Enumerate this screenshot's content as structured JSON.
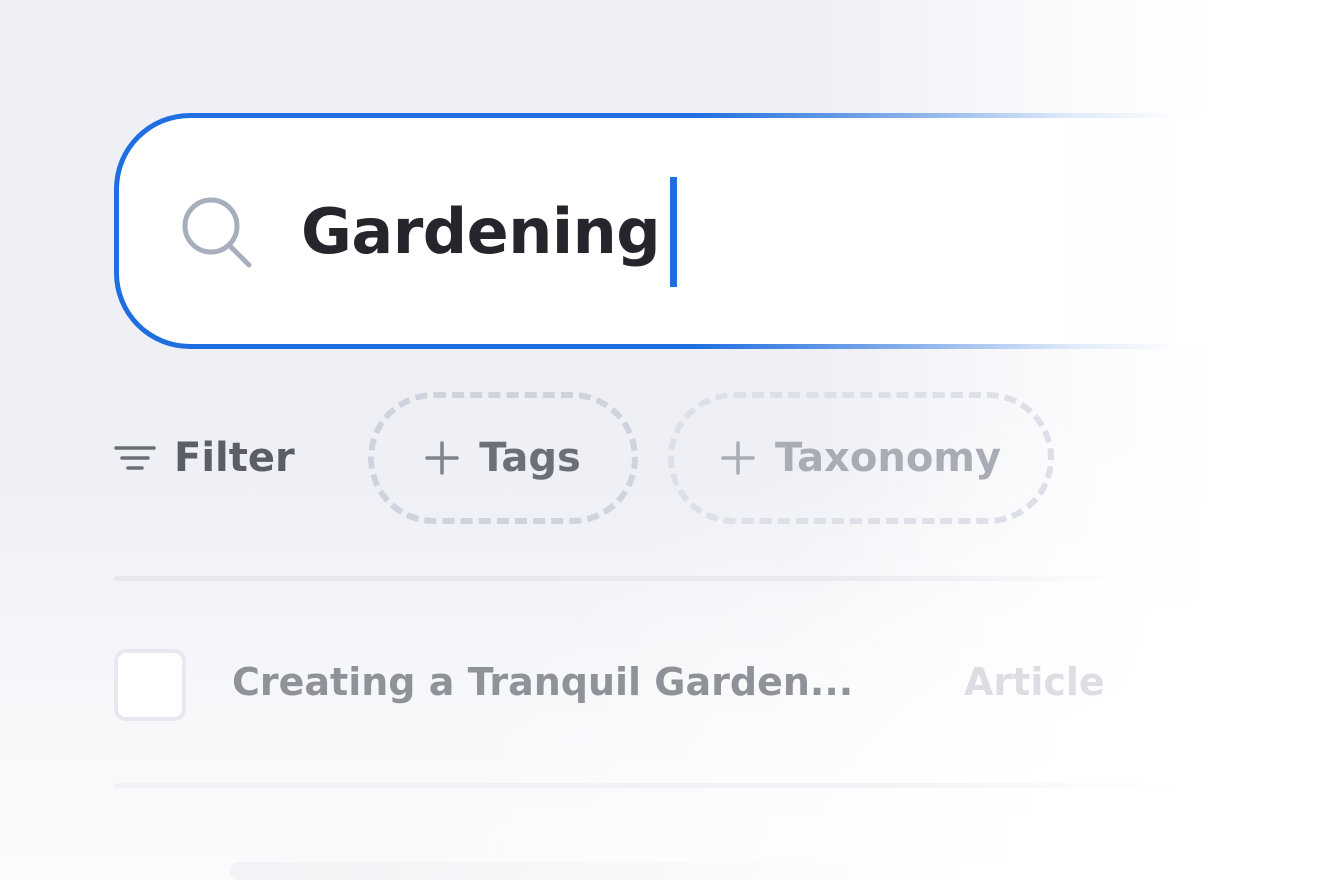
{
  "search": {
    "value": "Gardening",
    "accent_color": "#1f6fe0",
    "icon": "search-icon"
  },
  "filters": {
    "filter_label": "Filter",
    "filter_icon": "filter-lines-icon",
    "chips": [
      {
        "label": "Tags",
        "icon": "plus-icon"
      },
      {
        "label": "Taxonomy",
        "icon": "plus-icon"
      }
    ]
  },
  "results": {
    "rows": [
      {
        "title": "Creating a Tranquil Garden...",
        "type": "Article",
        "checked": false
      }
    ]
  }
}
